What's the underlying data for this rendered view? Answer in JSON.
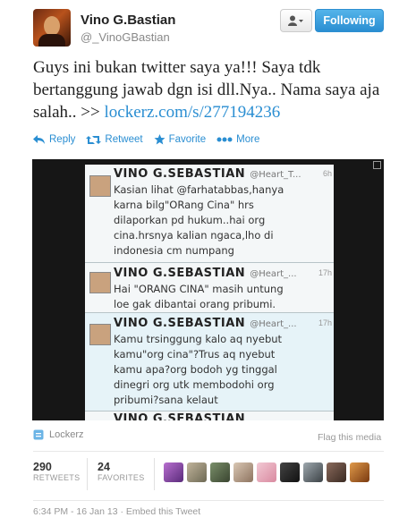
{
  "header": {
    "name": "Vino G.Bastian",
    "handle": "@_VinoGBastian",
    "follow_label": "Following"
  },
  "tweet": {
    "text": "Guys ini bukan twitter saya ya!!! Saya tdk bertanggung jawab dgn isi dll.Nya.. Nama saya aja salah.. >> ",
    "link": "lockerz.com/s/277194236"
  },
  "actions": {
    "reply": "Reply",
    "retweet": "Retweet",
    "favorite": "Favorite",
    "more": "More"
  },
  "media": {
    "posts": [
      {
        "name": "VINO G.SEBASTIAN",
        "handle": "@Heart_T...",
        "time": "6h",
        "lines": [
          "Kasian lihat @farhatabbas,hanya",
          "karna bilg\"ORang Cina\" hrs",
          "dilaporkan pd hukum..hai org",
          "cina.hrsnya kalian ngaca,lho di",
          "indonesia cm numpang"
        ]
      },
      {
        "name": "VINO G.SEBASTIAN",
        "handle": "@Heart_...",
        "time": "17h",
        "lines": [
          "Hai \"ORANG CINA\" masih untung",
          "loe gak dibantai orang pribumi."
        ]
      },
      {
        "name": "VINO G.SEBASTIAN",
        "handle": "@Heart_...",
        "time": "17h",
        "lines": [
          "Kamu trsinggung kalo aq nyebut",
          "kamu\"org cina\"?Trus aq nyebut",
          "kamu apa?org bodoh yg tinggal",
          "dinegri org utk membodohi org",
          "pribumi?sana kelaut"
        ]
      },
      {
        "name": "VINO G.SEBASTIAN",
        "handle": "",
        "time": "",
        "lines": []
      }
    ]
  },
  "source": {
    "label": "Lockerz",
    "flag": "Flag this media"
  },
  "stats": {
    "retweets_count": "290",
    "retweets_label": "RETWEETS",
    "favorites_count": "24",
    "favorites_label": "FAVORITES"
  },
  "footer": {
    "timestamp": "6:34 PM - 16 Jan 13",
    "separator": "·",
    "embed": "Embed this Tweet"
  },
  "colors": {
    "link": "#2a8ed2",
    "follow_button": "#2a8ed2"
  }
}
